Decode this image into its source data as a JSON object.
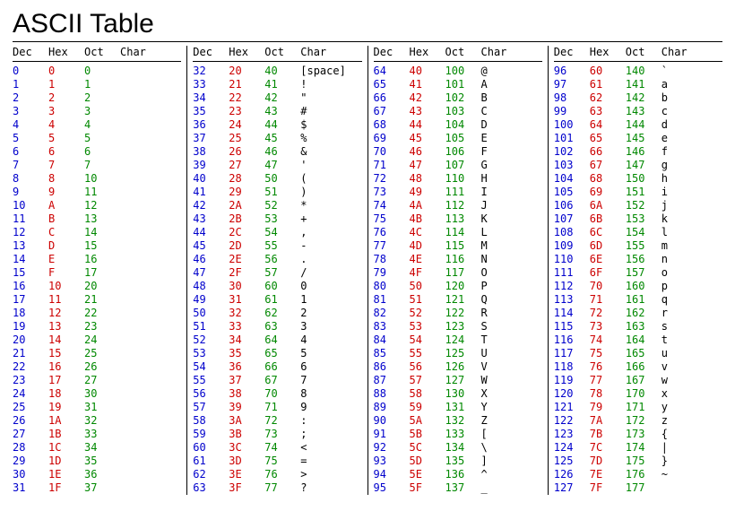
{
  "title": "ASCII Table",
  "headers": {
    "dec": "Dec",
    "hex": "Hex",
    "oct": "Oct",
    "char": "Char"
  },
  "rows": [
    {
      "d": "0",
      "h": "0",
      "o": "0",
      "c": ""
    },
    {
      "d": "1",
      "h": "1",
      "o": "1",
      "c": ""
    },
    {
      "d": "2",
      "h": "2",
      "o": "2",
      "c": ""
    },
    {
      "d": "3",
      "h": "3",
      "o": "3",
      "c": ""
    },
    {
      "d": "4",
      "h": "4",
      "o": "4",
      "c": ""
    },
    {
      "d": "5",
      "h": "5",
      "o": "5",
      "c": ""
    },
    {
      "d": "6",
      "h": "6",
      "o": "6",
      "c": ""
    },
    {
      "d": "7",
      "h": "7",
      "o": "7",
      "c": ""
    },
    {
      "d": "8",
      "h": "8",
      "o": "10",
      "c": ""
    },
    {
      "d": "9",
      "h": "9",
      "o": "11",
      "c": ""
    },
    {
      "d": "10",
      "h": "A",
      "o": "12",
      "c": ""
    },
    {
      "d": "11",
      "h": "B",
      "o": "13",
      "c": ""
    },
    {
      "d": "12",
      "h": "C",
      "o": "14",
      "c": ""
    },
    {
      "d": "13",
      "h": "D",
      "o": "15",
      "c": ""
    },
    {
      "d": "14",
      "h": "E",
      "o": "16",
      "c": ""
    },
    {
      "d": "15",
      "h": "F",
      "o": "17",
      "c": ""
    },
    {
      "d": "16",
      "h": "10",
      "o": "20",
      "c": ""
    },
    {
      "d": "17",
      "h": "11",
      "o": "21",
      "c": ""
    },
    {
      "d": "18",
      "h": "12",
      "o": "22",
      "c": ""
    },
    {
      "d": "19",
      "h": "13",
      "o": "23",
      "c": ""
    },
    {
      "d": "20",
      "h": "14",
      "o": "24",
      "c": ""
    },
    {
      "d": "21",
      "h": "15",
      "o": "25",
      "c": ""
    },
    {
      "d": "22",
      "h": "16",
      "o": "26",
      "c": ""
    },
    {
      "d": "23",
      "h": "17",
      "o": "27",
      "c": ""
    },
    {
      "d": "24",
      "h": "18",
      "o": "30",
      "c": ""
    },
    {
      "d": "25",
      "h": "19",
      "o": "31",
      "c": ""
    },
    {
      "d": "26",
      "h": "1A",
      "o": "32",
      "c": ""
    },
    {
      "d": "27",
      "h": "1B",
      "o": "33",
      "c": ""
    },
    {
      "d": "28",
      "h": "1C",
      "o": "34",
      "c": ""
    },
    {
      "d": "29",
      "h": "1D",
      "o": "35",
      "c": ""
    },
    {
      "d": "30",
      "h": "1E",
      "o": "36",
      "c": ""
    },
    {
      "d": "31",
      "h": "1F",
      "o": "37",
      "c": ""
    },
    {
      "d": "32",
      "h": "20",
      "o": "40",
      "c": "[space]"
    },
    {
      "d": "33",
      "h": "21",
      "o": "41",
      "c": "!"
    },
    {
      "d": "34",
      "h": "22",
      "o": "42",
      "c": "\""
    },
    {
      "d": "35",
      "h": "23",
      "o": "43",
      "c": "#"
    },
    {
      "d": "36",
      "h": "24",
      "o": "44",
      "c": "$"
    },
    {
      "d": "37",
      "h": "25",
      "o": "45",
      "c": "%"
    },
    {
      "d": "38",
      "h": "26",
      "o": "46",
      "c": "&"
    },
    {
      "d": "39",
      "h": "27",
      "o": "47",
      "c": "'"
    },
    {
      "d": "40",
      "h": "28",
      "o": "50",
      "c": "("
    },
    {
      "d": "41",
      "h": "29",
      "o": "51",
      "c": ")"
    },
    {
      "d": "42",
      "h": "2A",
      "o": "52",
      "c": "*"
    },
    {
      "d": "43",
      "h": "2B",
      "o": "53",
      "c": "+"
    },
    {
      "d": "44",
      "h": "2C",
      "o": "54",
      "c": ","
    },
    {
      "d": "45",
      "h": "2D",
      "o": "55",
      "c": "-"
    },
    {
      "d": "46",
      "h": "2E",
      "o": "56",
      "c": "."
    },
    {
      "d": "47",
      "h": "2F",
      "o": "57",
      "c": "/"
    },
    {
      "d": "48",
      "h": "30",
      "o": "60",
      "c": "0"
    },
    {
      "d": "49",
      "h": "31",
      "o": "61",
      "c": "1"
    },
    {
      "d": "50",
      "h": "32",
      "o": "62",
      "c": "2"
    },
    {
      "d": "51",
      "h": "33",
      "o": "63",
      "c": "3"
    },
    {
      "d": "52",
      "h": "34",
      "o": "64",
      "c": "4"
    },
    {
      "d": "53",
      "h": "35",
      "o": "65",
      "c": "5"
    },
    {
      "d": "54",
      "h": "36",
      "o": "66",
      "c": "6"
    },
    {
      "d": "55",
      "h": "37",
      "o": "67",
      "c": "7"
    },
    {
      "d": "56",
      "h": "38",
      "o": "70",
      "c": "8"
    },
    {
      "d": "57",
      "h": "39",
      "o": "71",
      "c": "9"
    },
    {
      "d": "58",
      "h": "3A",
      "o": "72",
      "c": ":"
    },
    {
      "d": "59",
      "h": "3B",
      "o": "73",
      "c": ";"
    },
    {
      "d": "60",
      "h": "3C",
      "o": "74",
      "c": "<"
    },
    {
      "d": "61",
      "h": "3D",
      "o": "75",
      "c": "="
    },
    {
      "d": "62",
      "h": "3E",
      "o": "76",
      "c": ">"
    },
    {
      "d": "63",
      "h": "3F",
      "o": "77",
      "c": "?"
    },
    {
      "d": "64",
      "h": "40",
      "o": "100",
      "c": "@"
    },
    {
      "d": "65",
      "h": "41",
      "o": "101",
      "c": "A"
    },
    {
      "d": "66",
      "h": "42",
      "o": "102",
      "c": "B"
    },
    {
      "d": "67",
      "h": "43",
      "o": "103",
      "c": "C"
    },
    {
      "d": "68",
      "h": "44",
      "o": "104",
      "c": "D"
    },
    {
      "d": "69",
      "h": "45",
      "o": "105",
      "c": "E"
    },
    {
      "d": "70",
      "h": "46",
      "o": "106",
      "c": "F"
    },
    {
      "d": "71",
      "h": "47",
      "o": "107",
      "c": "G"
    },
    {
      "d": "72",
      "h": "48",
      "o": "110",
      "c": "H"
    },
    {
      "d": "73",
      "h": "49",
      "o": "111",
      "c": "I"
    },
    {
      "d": "74",
      "h": "4A",
      "o": "112",
      "c": "J"
    },
    {
      "d": "75",
      "h": "4B",
      "o": "113",
      "c": "K"
    },
    {
      "d": "76",
      "h": "4C",
      "o": "114",
      "c": "L"
    },
    {
      "d": "77",
      "h": "4D",
      "o": "115",
      "c": "M"
    },
    {
      "d": "78",
      "h": "4E",
      "o": "116",
      "c": "N"
    },
    {
      "d": "79",
      "h": "4F",
      "o": "117",
      "c": "O"
    },
    {
      "d": "80",
      "h": "50",
      "o": "120",
      "c": "P"
    },
    {
      "d": "81",
      "h": "51",
      "o": "121",
      "c": "Q"
    },
    {
      "d": "82",
      "h": "52",
      "o": "122",
      "c": "R"
    },
    {
      "d": "83",
      "h": "53",
      "o": "123",
      "c": "S"
    },
    {
      "d": "84",
      "h": "54",
      "o": "124",
      "c": "T"
    },
    {
      "d": "85",
      "h": "55",
      "o": "125",
      "c": "U"
    },
    {
      "d": "86",
      "h": "56",
      "o": "126",
      "c": "V"
    },
    {
      "d": "87",
      "h": "57",
      "o": "127",
      "c": "W"
    },
    {
      "d": "88",
      "h": "58",
      "o": "130",
      "c": "X"
    },
    {
      "d": "89",
      "h": "59",
      "o": "131",
      "c": "Y"
    },
    {
      "d": "90",
      "h": "5A",
      "o": "132",
      "c": "Z"
    },
    {
      "d": "91",
      "h": "5B",
      "o": "133",
      "c": "["
    },
    {
      "d": "92",
      "h": "5C",
      "o": "134",
      "c": "\\"
    },
    {
      "d": "93",
      "h": "5D",
      "o": "135",
      "c": "]"
    },
    {
      "d": "94",
      "h": "5E",
      "o": "136",
      "c": "^"
    },
    {
      "d": "95",
      "h": "5F",
      "o": "137",
      "c": "_"
    },
    {
      "d": "96",
      "h": "60",
      "o": "140",
      "c": "`"
    },
    {
      "d": "97",
      "h": "61",
      "o": "141",
      "c": "a"
    },
    {
      "d": "98",
      "h": "62",
      "o": "142",
      "c": "b"
    },
    {
      "d": "99",
      "h": "63",
      "o": "143",
      "c": "c"
    },
    {
      "d": "100",
      "h": "64",
      "o": "144",
      "c": "d"
    },
    {
      "d": "101",
      "h": "65",
      "o": "145",
      "c": "e"
    },
    {
      "d": "102",
      "h": "66",
      "o": "146",
      "c": "f"
    },
    {
      "d": "103",
      "h": "67",
      "o": "147",
      "c": "g"
    },
    {
      "d": "104",
      "h": "68",
      "o": "150",
      "c": "h"
    },
    {
      "d": "105",
      "h": "69",
      "o": "151",
      "c": "i"
    },
    {
      "d": "106",
      "h": "6A",
      "o": "152",
      "c": "j"
    },
    {
      "d": "107",
      "h": "6B",
      "o": "153",
      "c": "k"
    },
    {
      "d": "108",
      "h": "6C",
      "o": "154",
      "c": "l"
    },
    {
      "d": "109",
      "h": "6D",
      "o": "155",
      "c": "m"
    },
    {
      "d": "110",
      "h": "6E",
      "o": "156",
      "c": "n"
    },
    {
      "d": "111",
      "h": "6F",
      "o": "157",
      "c": "o"
    },
    {
      "d": "112",
      "h": "70",
      "o": "160",
      "c": "p"
    },
    {
      "d": "113",
      "h": "71",
      "o": "161",
      "c": "q"
    },
    {
      "d": "114",
      "h": "72",
      "o": "162",
      "c": "r"
    },
    {
      "d": "115",
      "h": "73",
      "o": "163",
      "c": "s"
    },
    {
      "d": "116",
      "h": "74",
      "o": "164",
      "c": "t"
    },
    {
      "d": "117",
      "h": "75",
      "o": "165",
      "c": "u"
    },
    {
      "d": "118",
      "h": "76",
      "o": "166",
      "c": "v"
    },
    {
      "d": "119",
      "h": "77",
      "o": "167",
      "c": "w"
    },
    {
      "d": "120",
      "h": "78",
      "o": "170",
      "c": "x"
    },
    {
      "d": "121",
      "h": "79",
      "o": "171",
      "c": "y"
    },
    {
      "d": "122",
      "h": "7A",
      "o": "172",
      "c": "z"
    },
    {
      "d": "123",
      "h": "7B",
      "o": "173",
      "c": "{"
    },
    {
      "d": "124",
      "h": "7C",
      "o": "174",
      "c": "|"
    },
    {
      "d": "125",
      "h": "7D",
      "o": "175",
      "c": "}"
    },
    {
      "d": "126",
      "h": "7E",
      "o": "176",
      "c": "~"
    },
    {
      "d": "127",
      "h": "7F",
      "o": "177",
      "c": ""
    }
  ]
}
